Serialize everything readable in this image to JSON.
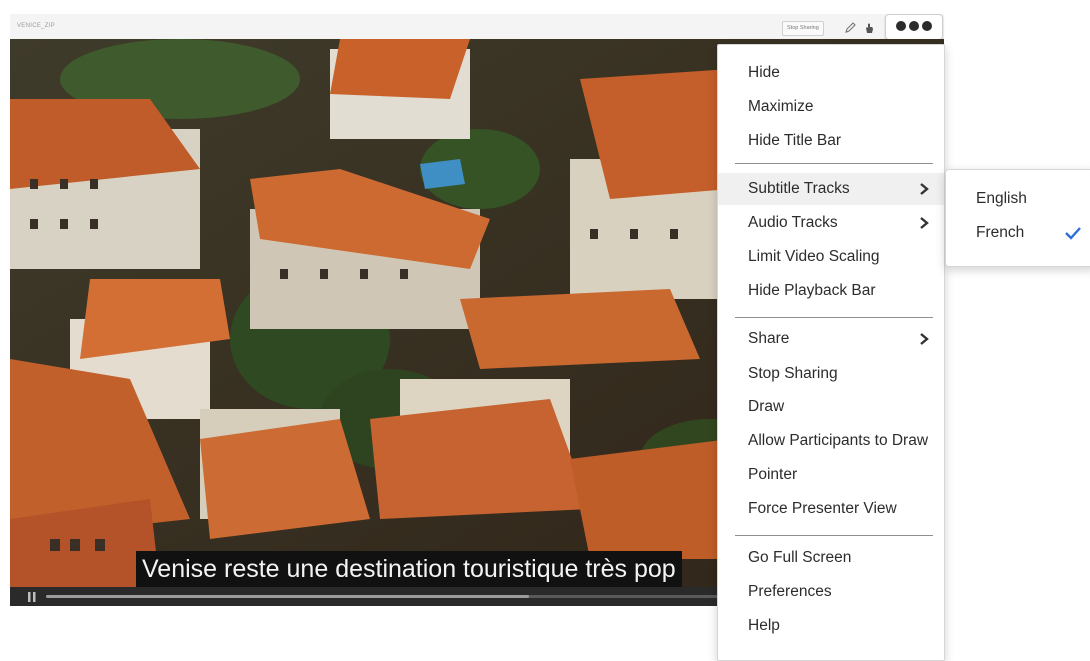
{
  "pod": {
    "title": "VENICE_ZIP",
    "stop_sharing_label": "Stop Sharing",
    "draw_icon": "pencil-icon",
    "pointer_icon": "hand-pointer-icon",
    "more_icon": "more-options-icon"
  },
  "video": {
    "subtitle": "Venise reste une destination touristique très pop",
    "progress": 0.71,
    "state_icon": "pause-icon"
  },
  "menu": {
    "items": [
      {
        "label": "Hide"
      },
      {
        "label": "Maximize"
      },
      {
        "label": "Hide Title Bar"
      },
      {
        "label": "Subtitle Tracks",
        "has_submenu": true,
        "highlighted": true
      },
      {
        "label": "Audio Tracks",
        "has_submenu": true
      },
      {
        "label": "Limit Video Scaling"
      },
      {
        "label": "Hide Playback Bar"
      },
      {
        "label": "Share",
        "has_submenu": true
      },
      {
        "label": "Stop Sharing"
      },
      {
        "label": "Draw"
      },
      {
        "label": "Allow Participants to Draw"
      },
      {
        "label": "Pointer"
      },
      {
        "label": "Force Presenter View"
      },
      {
        "label": "Go Full Screen"
      },
      {
        "label": "Preferences"
      },
      {
        "label": "Help"
      }
    ]
  },
  "subtitle_menu": {
    "items": [
      {
        "label": "English",
        "checked": false
      },
      {
        "label": "French",
        "checked": true
      }
    ]
  },
  "colors": {
    "accent_check": "#2b6fd6",
    "menu_text": "#2c2c2c",
    "highlight": "#f0f0f0",
    "roof": "#c8632a"
  }
}
